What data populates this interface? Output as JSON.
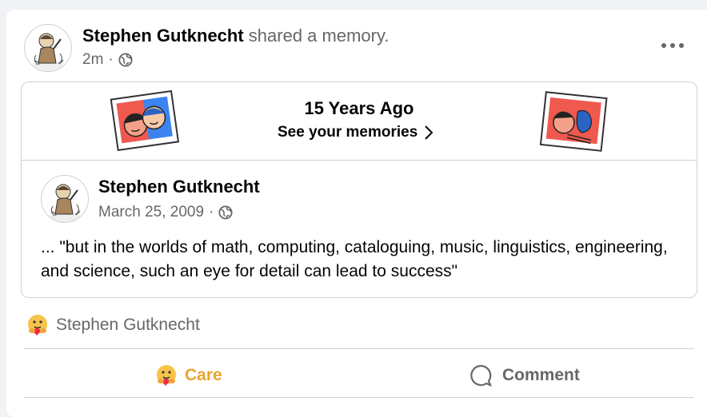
{
  "post": {
    "author": "Stephen Gutknecht",
    "action": " shared a memory.",
    "time": "2m",
    "separator": "·",
    "icons": {
      "audience": "globe-icon",
      "more": "more-options-icon"
    }
  },
  "memory": {
    "title": "15 Years Ago",
    "link": "See your memories",
    "link_icon": "chevron-right-icon"
  },
  "shared_post": {
    "author": "Stephen Gutknecht",
    "date": "March 25, 2009",
    "separator": "·",
    "text": "... \"but in the worlds of math, computing, cataloguing, music, linguistics, engineering, and science, such an eye for detail can lead to success\""
  },
  "reactions": {
    "icon": "care-emoji-icon",
    "names": "Stephen Gutknecht"
  },
  "actions": {
    "care": "Care",
    "comment": "Comment",
    "care_color": "#e8a530",
    "comment_color": "#65676b"
  }
}
